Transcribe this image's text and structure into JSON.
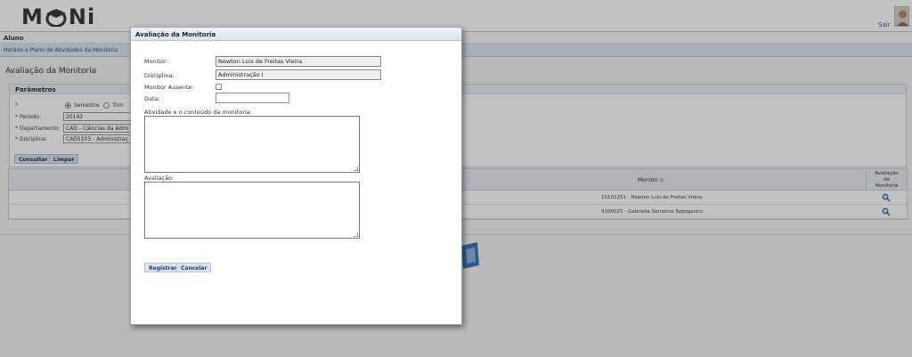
{
  "header": {
    "logo": "MONI",
    "logout_label": "Sair"
  },
  "role_label": "Aluno",
  "menu": {
    "breadcrumb": "Horário e Plano de Atividades da Monitoria"
  },
  "page": {
    "title": "Avaliação da Monitoria"
  },
  "params": {
    "title": "Parâmetros",
    "radio_semestre": "Semestre",
    "radio_trimestre": "Trim",
    "periodo_label": "* Período:",
    "periodo_value": "20142",
    "departamento_label": "* Departamento:",
    "departamento_value": "CAD - Ciências da Admi",
    "disciplina_label": "* Disciplina:",
    "disciplina_value": "CAD5103 - Administraç",
    "consultar_label": "Consultar",
    "limpar_label": "Limpar"
  },
  "results": {
    "col_monitor": "Monitor ◇",
    "col_avaliacao": [
      "Avaliação",
      "da",
      "Monitoria"
    ],
    "rows": [
      {
        "monitor": "10101251 - Newton Luis de Freitas Vieira"
      },
      {
        "monitor": "9100025 - Gabriella Serratine Szpoganicz"
      }
    ]
  },
  "dialog": {
    "title": "Avaliação da Monitoria",
    "monitor_label": "Monitor:",
    "monitor_value": "Newton Luis de Freitas Vieira",
    "disciplina_label": "Disciplina:",
    "disciplina_value": "Administração I",
    "ausente_label": "Monitor Ausente:",
    "data_label": "Data:",
    "data_value": "",
    "atividade_label": "Atividade e o conteúdo da monitoria:",
    "atividade_value": "",
    "avaliacao_label": "Avaliação:",
    "avaliacao_value": "",
    "registrar_label": "Registrar",
    "cancelar_label": "Cancelar"
  },
  "colors": {
    "accent": "#2a64a8",
    "header_blue": "#dde8f3",
    "button": "#dbe4ee"
  },
  "icons": {
    "zoom": "magnifier-icon",
    "checkbox": "checkbox-icon",
    "avatar": "user-avatar"
  }
}
